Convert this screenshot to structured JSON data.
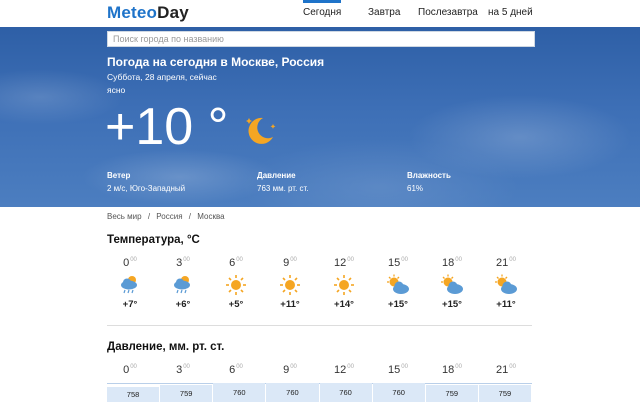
{
  "header": {
    "logo_part1": "Meteo",
    "logo_part2": "Day",
    "nav": [
      {
        "label": "Сегодня",
        "active": true
      },
      {
        "label": "Завтра",
        "active": false
      },
      {
        "label": "Послезавтра",
        "active": false
      },
      {
        "label": "на 5 дней",
        "active": false
      }
    ]
  },
  "search": {
    "placeholder": "Поиск города по названию"
  },
  "current": {
    "title": "Погода на сегодня в Москве, Россия",
    "date": "Суббота, 28 апреля, сейчас",
    "condition": "ясно",
    "temperature": "+10 °",
    "icon": "moon-stars-icon",
    "wind_label": "Ветер",
    "wind_value": "2 м/с, Юго-Западный",
    "pressure_label": "Давление",
    "pressure_value": "763 мм. рт. ст.",
    "humidity_label": "Влажность",
    "humidity_value": "61%"
  },
  "breadcrumb": [
    "Весь мир",
    "/",
    "Россия",
    "/",
    "Москва"
  ],
  "temperature_section": {
    "title": "Температура, °C",
    "hours": [
      {
        "hour": "0",
        "min": "00",
        "icon": "sun-cloud-rain-icon",
        "temp": "+7°"
      },
      {
        "hour": "3",
        "min": "00",
        "icon": "sun-cloud-rain-icon",
        "temp": "+6°"
      },
      {
        "hour": "6",
        "min": "00",
        "icon": "sun-icon",
        "temp": "+5°"
      },
      {
        "hour": "9",
        "min": "00",
        "icon": "sun-icon",
        "temp": "+11°"
      },
      {
        "hour": "12",
        "min": "00",
        "icon": "sun-icon",
        "temp": "+14°"
      },
      {
        "hour": "15",
        "min": "00",
        "icon": "sun-cloud-icon",
        "temp": "+15°"
      },
      {
        "hour": "18",
        "min": "00",
        "icon": "sun-cloud-icon",
        "temp": "+15°"
      },
      {
        "hour": "21",
        "min": "00",
        "icon": "sun-cloud-icon",
        "temp": "+11°"
      }
    ]
  },
  "pressure_section": {
    "title": "Давление, мм. рт. ст.",
    "hours": [
      {
        "hour": "0",
        "min": "00",
        "value": "758"
      },
      {
        "hour": "3",
        "min": "00",
        "value": "759"
      },
      {
        "hour": "6",
        "min": "00",
        "value": "760"
      },
      {
        "hour": "9",
        "min": "00",
        "value": "760"
      },
      {
        "hour": "12",
        "min": "00",
        "value": "760"
      },
      {
        "hour": "15",
        "min": "00",
        "value": "760"
      },
      {
        "hour": "18",
        "min": "00",
        "value": "759"
      },
      {
        "hour": "21",
        "min": "00",
        "value": "759"
      }
    ]
  },
  "colors": {
    "accent": "#1e73c9",
    "hero": "#3d6fb6",
    "sun": "#f5a623",
    "cloud": "#5b9bd5",
    "pressure_bar": "#dbe8f7"
  }
}
